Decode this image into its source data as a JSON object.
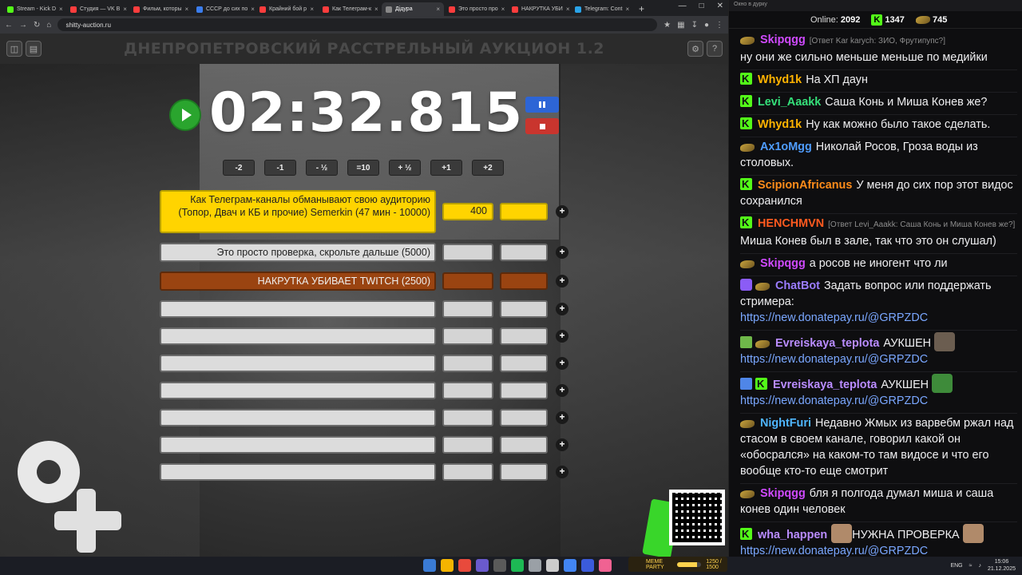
{
  "browser": {
    "tabs": [
      {
        "label": "Stream - Kick D",
        "color": "#53fc18",
        "active": false
      },
      {
        "label": "Студия — VK В",
        "color": "#ff3d3d",
        "active": false
      },
      {
        "label": "Фильм, которы",
        "color": "#ff3d3d",
        "active": false
      },
      {
        "label": "СССР до сих по",
        "color": "#3b7ded",
        "active": false
      },
      {
        "label": "Крайний бой р",
        "color": "#ff3d3d",
        "active": false
      },
      {
        "label": "Как Телеграм-к",
        "color": "#ff3d3d",
        "active": false
      },
      {
        "label": "Дідура",
        "color": "#888888",
        "active": true
      },
      {
        "label": "Это просто про",
        "color": "#ff3d3d",
        "active": false
      },
      {
        "label": "НАКРУТКА УБИ",
        "color": "#ff3d3d",
        "active": false
      },
      {
        "label": "Telegram: Cont",
        "color": "#2aa3e8",
        "active": false
      }
    ],
    "url": "shitty-auction.ru"
  },
  "page": {
    "title": "ДНЕПРОПЕТРОВСКИЙ РАССТРЕЛЬНЫЙ АУКЦИОН 1.2",
    "timer": "02:32.815",
    "adjust_buttons": [
      "-2",
      "-1",
      "- ½",
      "=10",
      "+ ½",
      "+1",
      "+2"
    ],
    "lots": [
      {
        "name": "Как Телеграм-каналы обманывают свою аудиторию (Топор, Двач и КБ и прочие) Semerkin (47 мин - 10000)",
        "amount": "400",
        "style": "gold"
      },
      {
        "name": "Это просто проверка, скрольте дальше (5000)",
        "amount": "",
        "style": "grey"
      },
      {
        "name": "НАКРУТКА УБИВАЕТ TWITCH (2500)",
        "amount": "",
        "style": "brown"
      },
      {
        "name": "",
        "amount": "",
        "style": "empty"
      },
      {
        "name": "",
        "amount": "",
        "style": "empty"
      },
      {
        "name": "",
        "amount": "",
        "style": "empty"
      },
      {
        "name": "",
        "amount": "",
        "style": "empty"
      },
      {
        "name": "",
        "amount": "",
        "style": "empty"
      },
      {
        "name": "",
        "amount": "",
        "style": "empty"
      },
      {
        "name": "",
        "amount": "",
        "style": "empty"
      }
    ]
  },
  "chat": {
    "window_title": "Окно в дурку",
    "online_label": "Online:",
    "online_count": "2092",
    "kick_count": "1347",
    "gun_count": "745",
    "messages": [
      {
        "badges": [
          "gun"
        ],
        "user": "Skipqgg",
        "color": "#d04aff",
        "reply": "[Ответ Kar karych: ЗИО, Фрутипупс?]",
        "text": "ну они же сильно меньше меньше по медийки"
      },
      {
        "badges": [
          "kick"
        ],
        "user": "Whyd1k",
        "color": "#ffb300",
        "reply": "",
        "text": "На ХП даун"
      },
      {
        "badges": [
          "kick"
        ],
        "user": "Levi_Aaakk",
        "color": "#35e07a",
        "reply": "",
        "text": "Саша Конь и Миша Конев же?"
      },
      {
        "badges": [
          "kick"
        ],
        "user": "Whyd1k",
        "color": "#ffb300",
        "reply": "",
        "text": "Ну как можно было такое сделать."
      },
      {
        "badges": [
          "gun"
        ],
        "user": "Ax1oMgg",
        "color": "#4f9dff",
        "reply": "",
        "text": "Николай Росов, Гроза воды из столовых."
      },
      {
        "badges": [
          "kick"
        ],
        "user": "ScipionAfricanus",
        "color": "#ff8c1a",
        "reply": "",
        "text": "У меня до сих пор этот видос сохранился"
      },
      {
        "badges": [
          "kick"
        ],
        "user": "HENCHMVN",
        "color": "#ff5a1f",
        "reply": "[Ответ Levi_Aaakk: Саша Конь и Миша Конев же?]",
        "text": "Миша Конев был в зале, так что это он слушал)"
      },
      {
        "badges": [
          "gun"
        ],
        "user": "Skipqgg",
        "color": "#d04aff",
        "reply": "",
        "text": "а росов не иногент что ли"
      },
      {
        "badges": [
          "bot",
          "gun"
        ],
        "user": "ChatBot",
        "color": "#9b7cff",
        "reply": "",
        "text": "Задать вопрос или поддержать стримера:",
        "link": "https://new.donatepay.ru/@GRPZDC"
      },
      {
        "badges": [
          "pencil",
          "gun"
        ],
        "user": "Evreiskaya_teplota",
        "color": "#b98cff",
        "reply": "",
        "text": "АУКШЕН",
        "emote": "#6b5d50",
        "link": "https://new.donatepay.ru/@GRPZDC"
      },
      {
        "badges": [
          "sword",
          "kick"
        ],
        "user": "Evreiskaya_teplota",
        "color": "#b98cff",
        "reply": "",
        "text": "АУКШЕН",
        "emote": "#3e8b3a",
        "link": "https://new.donatepay.ru/@GRPZDC"
      },
      {
        "badges": [
          "gun"
        ],
        "user": "NightFuri",
        "color": "#4fb6ff",
        "reply": "",
        "text": "Недавно Жмых из варвебм ржал над стасом в своем канале, говорил какой он «обосрался» на каком-то там видосе и что его вообще кто-то еще смотрит"
      },
      {
        "badges": [
          "gun"
        ],
        "user": "Skipqgg",
        "color": "#d04aff",
        "reply": "",
        "text": "бля я полгода думал миша и саша конев один человек"
      },
      {
        "badges": [
          "kick"
        ],
        "user": "wha_happen",
        "color": "#b98cff",
        "reply": "",
        "text": "НУЖНА ПРОВЕРКА",
        "emote": "#b08a6a",
        "emote2": "#b08a6a",
        "link": "https://new.donatepay.ru/@GRPZDC"
      }
    ]
  },
  "taskbar": {
    "meme_label": "MEME PARTY",
    "meme_progress_text": "1250 / 1500",
    "meme_progress": 0.83,
    "lang": "ENG",
    "time": "15:06",
    "date": "21.12.2025",
    "icons": [
      "#3a7bd5",
      "#f4b400",
      "#e84a3c",
      "#6a5acd",
      "#5a5a5a",
      "#1db954",
      "#9aa0a6",
      "#ccc",
      "#4285f4",
      "#3b5bdb",
      "#f06292"
    ]
  }
}
